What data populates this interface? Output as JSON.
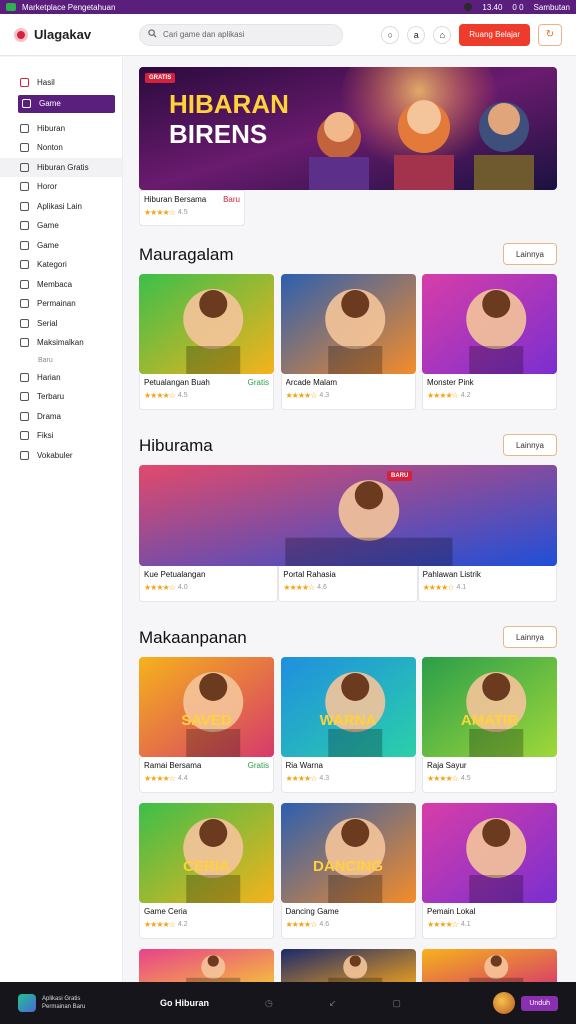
{
  "statusbar": {
    "title": "Marketplace Pengetahuan",
    "time": "13.40",
    "code": "0 0",
    "right_label": "Sambutan"
  },
  "header": {
    "brand": "Ulagakav",
    "search_placeholder": "Cari game dan aplikasi",
    "cta_label": "Ruang Belajar"
  },
  "sidebar": {
    "items": [
      {
        "label": "Hasil",
        "style": "red"
      },
      {
        "label": "Game",
        "style": "active"
      },
      {
        "label": "Hiburan",
        "style": ""
      },
      {
        "label": "Nonton",
        "style": ""
      },
      {
        "label": "Hiburan Gratis",
        "style": "sel"
      },
      {
        "label": "Horor",
        "style": ""
      },
      {
        "label": "Aplikasi Lain",
        "style": ""
      },
      {
        "label": "Game",
        "style": ""
      },
      {
        "label": "Game",
        "style": ""
      },
      {
        "label": "Kategori",
        "style": ""
      },
      {
        "label": "Membaca",
        "style": ""
      },
      {
        "label": "Permainan",
        "style": ""
      },
      {
        "label": "Serial",
        "style": ""
      },
      {
        "label": "Maksimalkan",
        "style": ""
      }
    ],
    "sub_label": "Baru",
    "items2": [
      {
        "label": "Harian"
      },
      {
        "label": "Terbaru"
      },
      {
        "label": "Drama"
      },
      {
        "label": "Fiksi"
      },
      {
        "label": "Vokabuler"
      }
    ]
  },
  "hero": {
    "badge": "GRATIS",
    "art_title_1": "HIBARAN",
    "art_title_2": "BIRENS",
    "caption": "Hiburan Bersama",
    "tag": "Baru",
    "rating_text": "4.5"
  },
  "sections": [
    {
      "title": "Mauragalam",
      "button": "Lainnya",
      "cards": [
        {
          "title": "Petualangan Buah",
          "tag": "Gratis",
          "rating": "4.5"
        },
        {
          "title": "Arcade Malam",
          "tag": "",
          "rating": "4.3"
        },
        {
          "title": "Monster Pink",
          "tag": "",
          "rating": "4.2"
        }
      ]
    },
    {
      "title": "Hiburama",
      "button": "Lainnya",
      "banners": [
        {
          "title": "Kue Petualangan",
          "rating": "4.0"
        },
        {
          "title": "Portal Rahasia",
          "rating": "4.6"
        },
        {
          "title": "Pahlawan Listrik",
          "rating": "4.1"
        }
      ],
      "badge": "BARU"
    },
    {
      "title": "Makaanpanan",
      "button": "Lainnya",
      "cards": [
        {
          "title": "Ramai Bersama",
          "tag": "Gratis",
          "rating": "4.4",
          "art": "SAVED"
        },
        {
          "title": "Ria Warna",
          "tag": "",
          "rating": "4.3",
          "art": "WARNA"
        },
        {
          "title": "Raja Sayur",
          "tag": "",
          "rating": "4.5",
          "art": "AMATIR"
        },
        {
          "title": "Game Ceria",
          "tag": "",
          "rating": "4.2",
          "art": "CERIA"
        },
        {
          "title": "Dancing Game",
          "tag": "",
          "rating": "4.6",
          "art": "DANCING"
        },
        {
          "title": "Pemain Lokal",
          "tag": "",
          "rating": "4.1",
          "art": ""
        }
      ]
    }
  ],
  "bottombar": {
    "app_line1": "Aplikasi Gratis",
    "app_line2": "Permainan Baru",
    "title": "Go Hiburan",
    "button": "Unduh"
  },
  "colors": {
    "accent": "#5a1e7c",
    "cta": "#ef3b2c",
    "star": "#f2a516"
  }
}
